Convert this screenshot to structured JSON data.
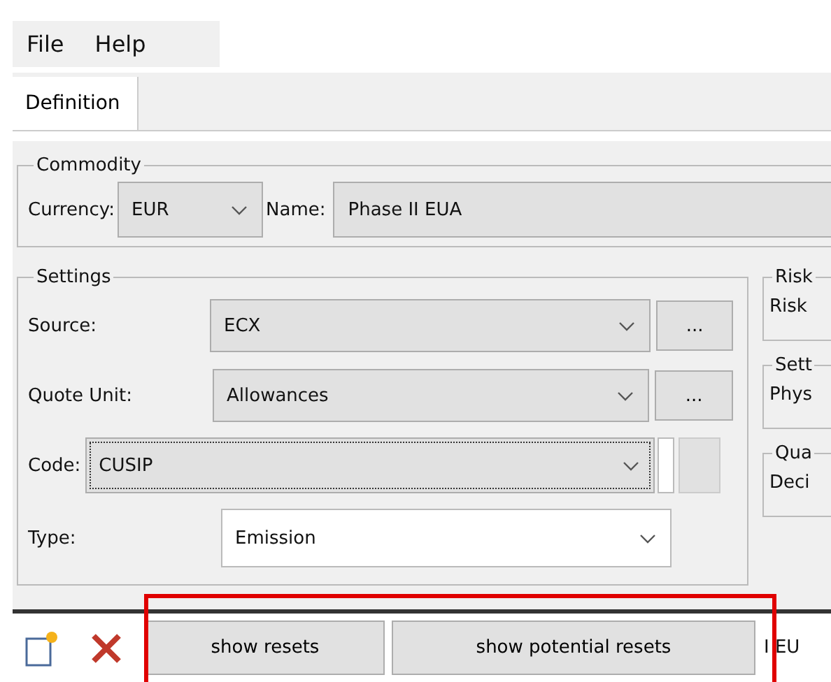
{
  "menu": [
    "File",
    "Help"
  ],
  "tabs": [
    {
      "label": "Definition",
      "selected": true
    }
  ],
  "commodity": {
    "title": "Commodity",
    "currency_label": "Currency:",
    "currency": "EUR",
    "name_label": "Name:",
    "name": "Phase II EUA"
  },
  "settings": {
    "title": "Settings",
    "rows": [
      {
        "kind": "picker",
        "label": "Source:",
        "value": "ECX",
        "button": "..."
      },
      {
        "kind": "picker",
        "label": "Quote Unit:",
        "value": "Allowances",
        "button": "..."
      },
      {
        "kind": "focused",
        "label": "Code:",
        "value": "CUSIP"
      },
      {
        "kind": "editable",
        "label": "Type:",
        "value": "Emission"
      }
    ]
  },
  "side_groups": [
    {
      "title": "Risk",
      "label": "Risk"
    },
    {
      "title": "Sett",
      "label": "Phys"
    },
    {
      "title": "Qua",
      "label": "Deci"
    }
  ],
  "toolbar": {
    "buttons": [
      "show resets",
      "show potential resets"
    ],
    "trailing_text": "I EU"
  }
}
